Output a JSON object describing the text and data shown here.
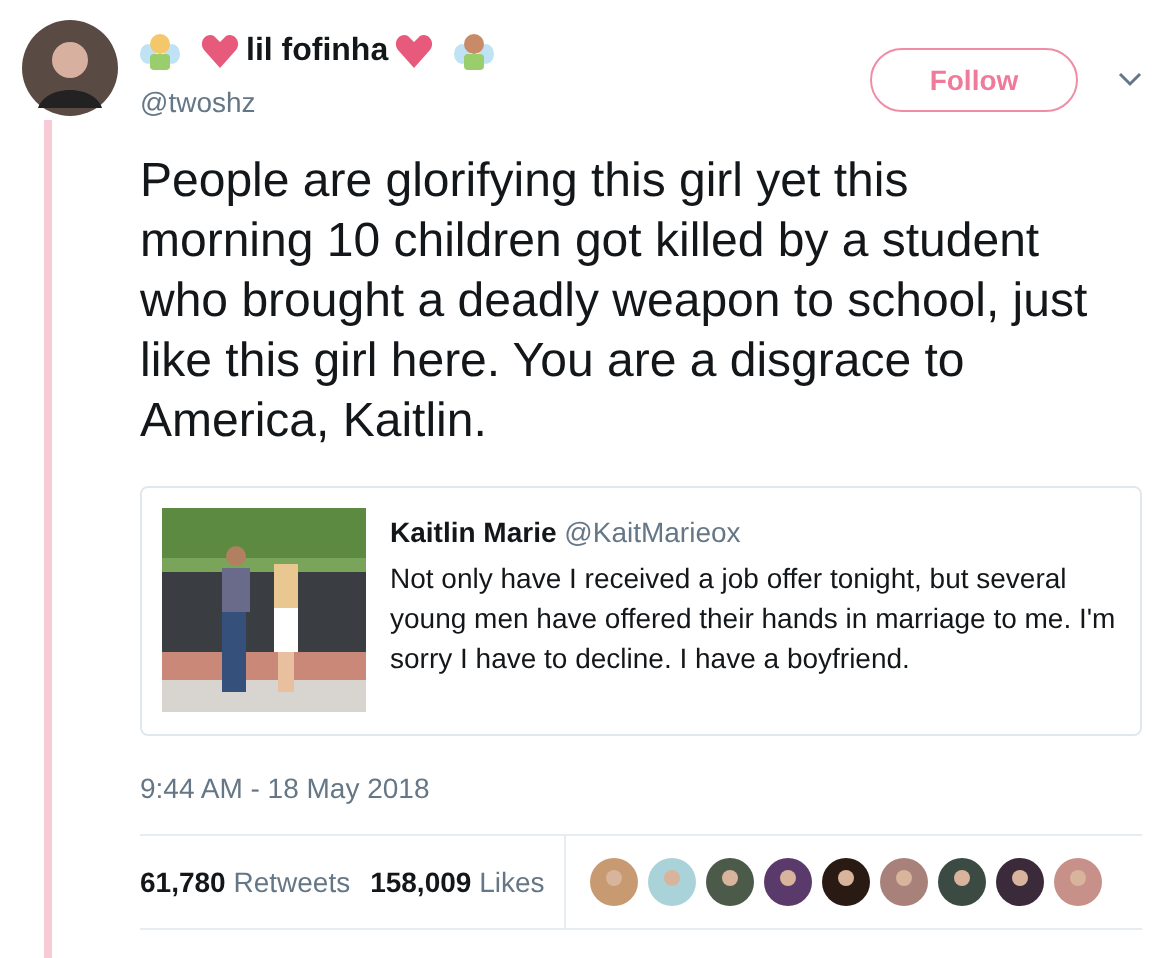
{
  "author": {
    "name": "lil fofinha",
    "handle": "@twoshz"
  },
  "follow_button": {
    "label": "Follow"
  },
  "tweet_text": "People are glorifying this girl yet this morning 10 children got killed by a student who brought a deadly weapon to school, just like this girl here. You are a disgrace to America, Kaitlin.",
  "quoted_tweet": {
    "name": "Kaitlin Marie",
    "handle": "@KaitMarieox",
    "text": "Not only have I received a job offer tonight, but several young men have offered their hands in marriage to me. I'm sorry I have to decline. I have a boyfriend."
  },
  "timestamp": "9:44 AM - 18 May 2018",
  "stats": [
    {
      "count": "61,780",
      "label": "Retweets"
    },
    {
      "count": "158,009",
      "label": "Likes"
    }
  ]
}
